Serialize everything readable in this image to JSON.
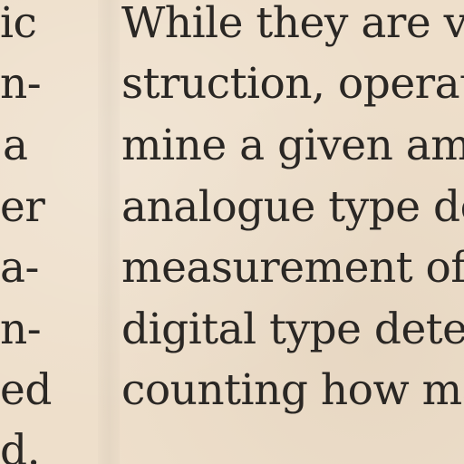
{
  "left_column": {
    "lines": [
      "ic",
      "n-",
      "a",
      "er",
      "a-",
      "n-",
      "ed",
      "d."
    ]
  },
  "right_column": {
    "lines": [
      "While they are v",
      "struction, operat",
      "mine a given am",
      "analogue type det",
      "measurement of",
      "digital type dete",
      "counting how ma"
    ]
  }
}
